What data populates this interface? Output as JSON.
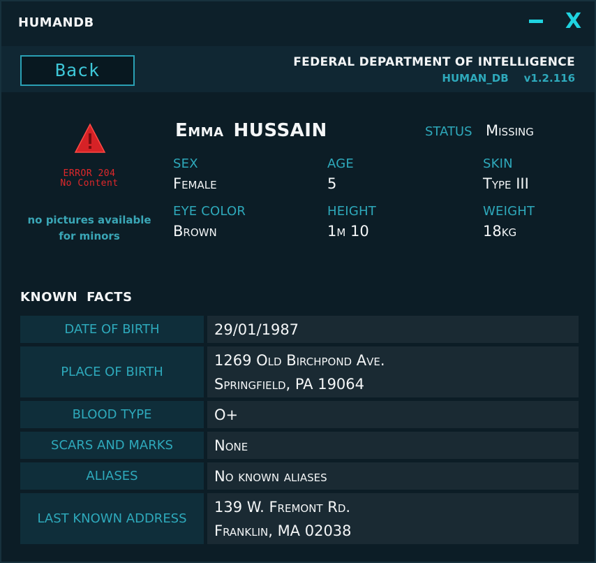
{
  "window": {
    "title": "HUMANDB",
    "minimize_label": "–",
    "close_label": "X"
  },
  "header": {
    "back_label": "Back",
    "agency": "FEDERAL DEPARTMENT OF INTELLIGENCE",
    "db_name": "HUMAN_DB",
    "version": "v1.2.116"
  },
  "photo": {
    "warning_icon": "warning-triangle-icon",
    "error_line1": "ERROR 204",
    "error_line2": "No Content",
    "note": "no pictures available for minors",
    "error_color": "#e0282b"
  },
  "person": {
    "first_name": "Emma",
    "last_name": "HUSSAIN",
    "status_label": "STATUS",
    "status_value": "Missing",
    "attributes": [
      {
        "label": "SEX",
        "value": "Female"
      },
      {
        "label": "AGE",
        "value": "5"
      },
      {
        "label": "SKIN",
        "value": "Type III"
      },
      {
        "label": "EYE COLOR",
        "value": "Brown"
      },
      {
        "label": "HEIGHT",
        "value": "1m 10"
      },
      {
        "label": "WEIGHT",
        "value": "18kg"
      }
    ]
  },
  "facts": {
    "title": "KNOWN FACTS",
    "rows": [
      {
        "label": "DATE OF BIRTH",
        "lines": [
          "29/01/1987"
        ]
      },
      {
        "label": "PLACE OF BIRTH",
        "lines": [
          "1269 Old Birchpond Ave.",
          "Springfield, PA 19064"
        ]
      },
      {
        "label": "BLOOD TYPE",
        "lines": [
          "O+"
        ]
      },
      {
        "label": "SCARS AND MARKS",
        "lines": [
          "None"
        ]
      },
      {
        "label": "ALIASES",
        "lines": [
          "No known aliases"
        ]
      },
      {
        "label": "LAST KNOWN ADDRESS",
        "lines": [
          "139 W. Fremont Rd.",
          "Franklin, MA 02038"
        ]
      }
    ]
  },
  "colors": {
    "accent": "#2ea9bb",
    "background": "#0c1d26",
    "error": "#e0282b"
  }
}
